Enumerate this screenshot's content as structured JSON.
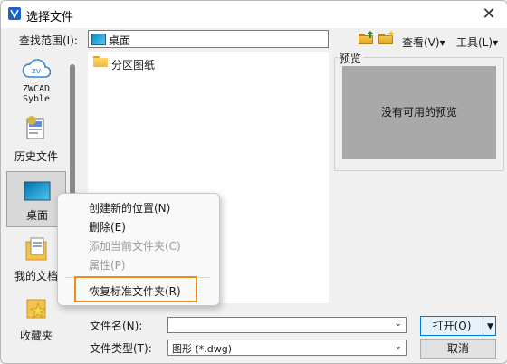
{
  "window": {
    "title": "选择文件",
    "close_glyph": "✕"
  },
  "toolbar": {
    "look_in_label": "查找范围(I):",
    "look_in_value": "桌面",
    "view_label": "查看(V)",
    "tools_label": "工具(L)",
    "dropdown_glyph": "▾"
  },
  "places": [
    {
      "label": "ZWCAD Syble",
      "icon": "zwcad-cloud-icon"
    },
    {
      "label": "历史文件",
      "icon": "history-files-icon"
    },
    {
      "label": "桌面",
      "icon": "desktop-icon"
    },
    {
      "label": "我的文档",
      "icon": "my-documents-icon"
    },
    {
      "label": "收藏夹",
      "icon": "favorites-icon"
    }
  ],
  "files": [
    {
      "name": "分区图纸",
      "icon": "folder-icon"
    }
  ],
  "preview": {
    "label": "预览",
    "empty_text": "没有可用的预览"
  },
  "bottom": {
    "filename_label": "文件名(N):",
    "filename_value": "",
    "filetype_label": "文件类型(T):",
    "filetype_value": "图形 (*.dwg)",
    "open_label": "打开(O)",
    "cancel_label": "取消"
  },
  "context_menu": {
    "items": [
      {
        "label": "创建新的位置(N)",
        "enabled": true
      },
      {
        "label": "删除(E)",
        "enabled": true
      },
      {
        "label": "添加当前文件夹(C)",
        "enabled": false
      },
      {
        "label": "属性(P)",
        "enabled": false
      },
      {
        "label": "恢复标准文件夹(R)",
        "enabled": true
      }
    ]
  },
  "colors": {
    "accent": "#0078d7",
    "highlight": "#f08c1a",
    "preview_bg": "#a9a9a9"
  }
}
